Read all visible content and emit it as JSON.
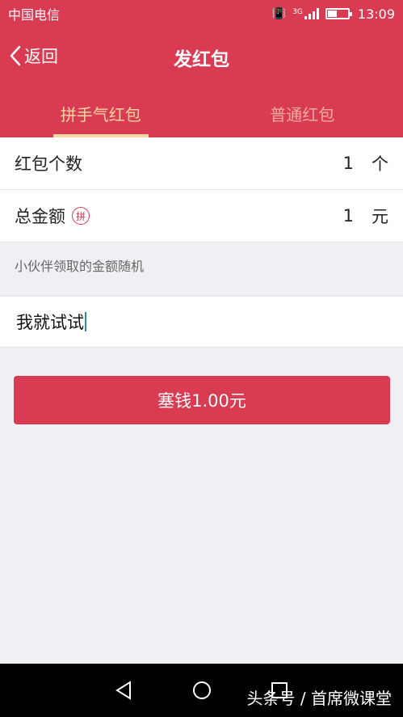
{
  "status_bar": {
    "carrier": "中国电信",
    "network": "3G",
    "time": "13:09"
  },
  "header": {
    "back_label": "返回",
    "title": "发红包"
  },
  "tabs": [
    {
      "label": "拼手气红包",
      "active": true
    },
    {
      "label": "普通红包",
      "active": false
    }
  ],
  "form": {
    "count_label": "红包个数",
    "count_value": "1",
    "count_unit": "个",
    "amount_label": "总金额",
    "amount_badge": "拼",
    "amount_value": "1",
    "amount_unit": "元",
    "hint": "小伙伴领取的金额随机",
    "message": "我就试试",
    "submit_label": "塞钱1.00元"
  },
  "watermark": "头条号 / 首席微课堂",
  "colors": {
    "brand": "#d93b52",
    "tab_active": "#f6d6a1",
    "tab_inactive": "#f1a9a6",
    "background": "#f0eff4"
  },
  "icons": {
    "back": "chevron-left-icon",
    "nav_back": "triangle-back-icon",
    "nav_home": "circle-home-icon",
    "nav_recent": "square-recent-icon"
  }
}
